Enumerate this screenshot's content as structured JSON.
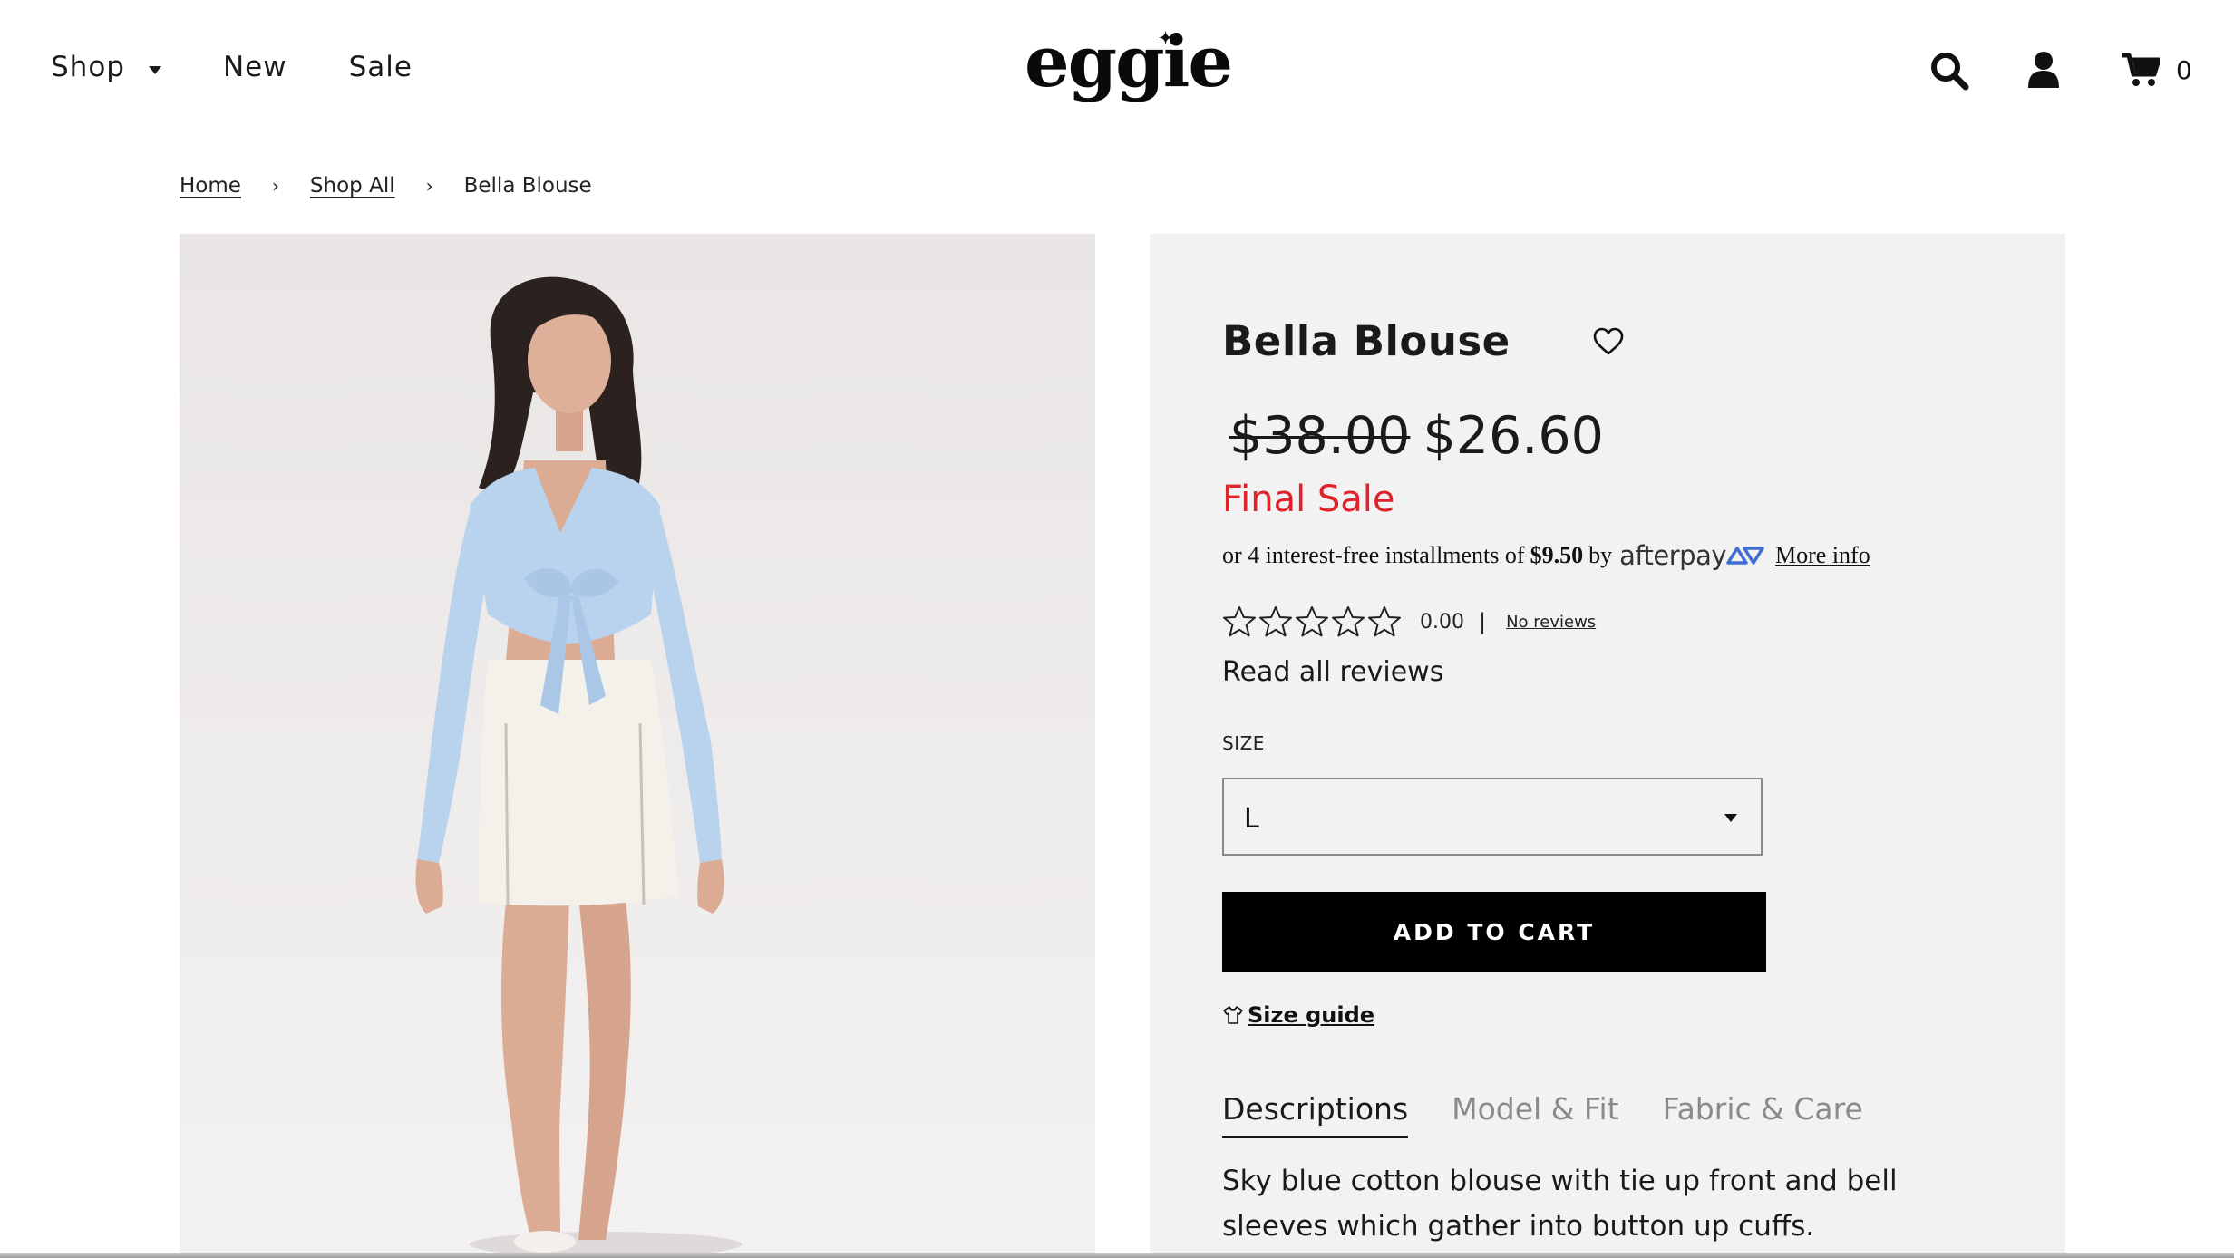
{
  "header": {
    "nav": [
      {
        "label": "Shop"
      },
      {
        "label": "New"
      },
      {
        "label": "Sale"
      }
    ],
    "logo_text": "eggie",
    "cart_count": "0"
  },
  "breadcrumb": {
    "home": "Home",
    "shop_all": "Shop All",
    "current": "Bella Blouse",
    "separator": "›"
  },
  "product": {
    "title": "Bella Blouse",
    "price_original": "$38.00",
    "price_sale": "$26.60",
    "sale_label": "Final Sale",
    "afterpay": {
      "prefix": "or 4 interest-free installments of",
      "amount": "$9.50",
      "by": "by",
      "brand": "afterpay",
      "more_info": "More info"
    },
    "rating": {
      "value": "0.00",
      "separator": "|",
      "reviews_link": "No reviews",
      "read_all": "Read all reviews",
      "stars_filled": 0,
      "stars_total": 5
    },
    "size": {
      "label": "SIZE",
      "selected": "L"
    },
    "add_to_cart": "ADD TO CART",
    "size_guide": "Size guide",
    "tabs": [
      {
        "label": "Descriptions",
        "active": true
      },
      {
        "label": "Model & Fit",
        "active": false
      },
      {
        "label": "Fabric & Care",
        "active": false
      }
    ],
    "description": "Sky blue cotton blouse with tie up front and bell sleeves which gather into button up cuffs."
  },
  "colors": {
    "sale_red": "#e0222b",
    "panel_bg": "#f2f2f2",
    "button_bg": "#000000",
    "blouse_blue": "#b9d3ee"
  }
}
